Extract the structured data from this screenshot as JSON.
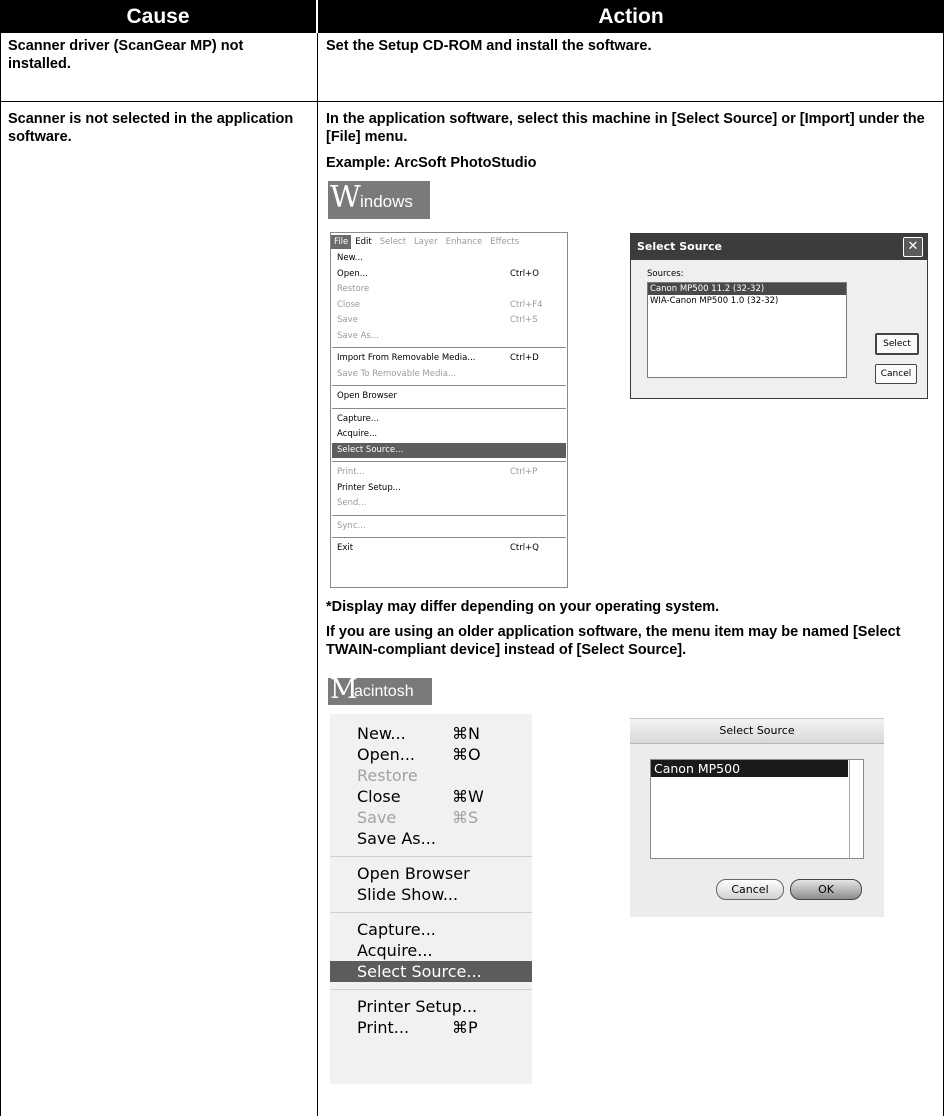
{
  "table": {
    "header_cause": "Cause",
    "header_action": "Action",
    "row1": {
      "cause": "Scanner driver (ScanGear MP) not installed.",
      "action": "Set the Setup CD-ROM and install the software."
    },
    "row2": {
      "cause": "Scanner is not selected in the application software.",
      "action_line1": "In the application software, select this machine in [Select Source] or [Import] under the [File] menu.",
      "example": "Example: ArcSoft PhotoStudio",
      "note1": "*Display may differ depending on your operating system.",
      "note2": "If you are using an older application software, the menu item may be named [Select TWAIN-compliant device] instead of [Select Source]."
    }
  },
  "windows": {
    "badge_initial": "W",
    "badge_rest": "indows",
    "menubar": [
      "File",
      "Edit",
      "Select",
      "Layer",
      "Enhance",
      "Effects"
    ],
    "menu": [
      {
        "label": "New...",
        "shortcut": "",
        "disabled": false
      },
      {
        "label": "Open...",
        "shortcut": "Ctrl+O",
        "disabled": false
      },
      {
        "label": "Restore",
        "shortcut": "",
        "disabled": true
      },
      {
        "label": "Close",
        "shortcut": "Ctrl+F4",
        "disabled": true
      },
      {
        "label": "Save",
        "shortcut": "Ctrl+S",
        "disabled": true
      },
      {
        "label": "Save As...",
        "shortcut": "",
        "disabled": true
      },
      {
        "label": "Import From Removable Media...",
        "shortcut": "Ctrl+D",
        "disabled": false
      },
      {
        "label": "Save To Removable Media...",
        "shortcut": "",
        "disabled": true
      },
      {
        "label": "Open Browser",
        "shortcut": "",
        "disabled": false
      },
      {
        "label": "Capture...",
        "shortcut": "",
        "disabled": false
      },
      {
        "label": "Acquire...",
        "shortcut": "",
        "disabled": false
      },
      {
        "label": "Select Source...",
        "shortcut": "",
        "disabled": false
      },
      {
        "label": "Print...",
        "shortcut": "Ctrl+P",
        "disabled": true
      },
      {
        "label": "Printer Setup...",
        "shortcut": "",
        "disabled": false
      },
      {
        "label": "Send...",
        "shortcut": "",
        "disabled": true
      },
      {
        "label": "Sync...",
        "shortcut": "",
        "disabled": true
      },
      {
        "label": "Exit",
        "shortcut": "Ctrl+Q",
        "disabled": false
      }
    ],
    "dialog": {
      "title": "Select Source",
      "close_glyph": "✕",
      "sources_label": "Sources:",
      "sources": [
        "Canon MP500 11.2 (32-32)",
        "WIA-Canon MP500 1.0 (32-32)"
      ],
      "select_button": "Select",
      "cancel_button": "Cancel"
    }
  },
  "mac": {
    "badge_initial": "M",
    "badge_rest": "acintosh",
    "menu": [
      {
        "label": "New...",
        "shortcut": "⌘N",
        "disabled": false
      },
      {
        "label": "Open...",
        "shortcut": "⌘O",
        "disabled": false
      },
      {
        "label": "Restore",
        "shortcut": "",
        "disabled": true
      },
      {
        "label": "Close",
        "shortcut": "⌘W",
        "disabled": false
      },
      {
        "label": "Save",
        "shortcut": "⌘S",
        "disabled": true
      },
      {
        "label": "Save As...",
        "shortcut": "",
        "disabled": false
      },
      {
        "label": "Open Browser",
        "shortcut": "",
        "disabled": false
      },
      {
        "label": "Slide Show...",
        "shortcut": "",
        "disabled": false
      },
      {
        "label": "Capture...",
        "shortcut": "",
        "disabled": false
      },
      {
        "label": "Acquire...",
        "shortcut": "",
        "disabled": false
      },
      {
        "label": "Select Source...",
        "shortcut": "",
        "disabled": false
      },
      {
        "label": "Printer Setup...",
        "shortcut": "",
        "disabled": false
      },
      {
        "label": "Print...",
        "shortcut": "⌘P",
        "disabled": false
      }
    ],
    "dialog": {
      "title": "Select Source",
      "sources": [
        "Canon MP500"
      ],
      "cancel_button": "Cancel",
      "ok_button": "OK"
    }
  }
}
